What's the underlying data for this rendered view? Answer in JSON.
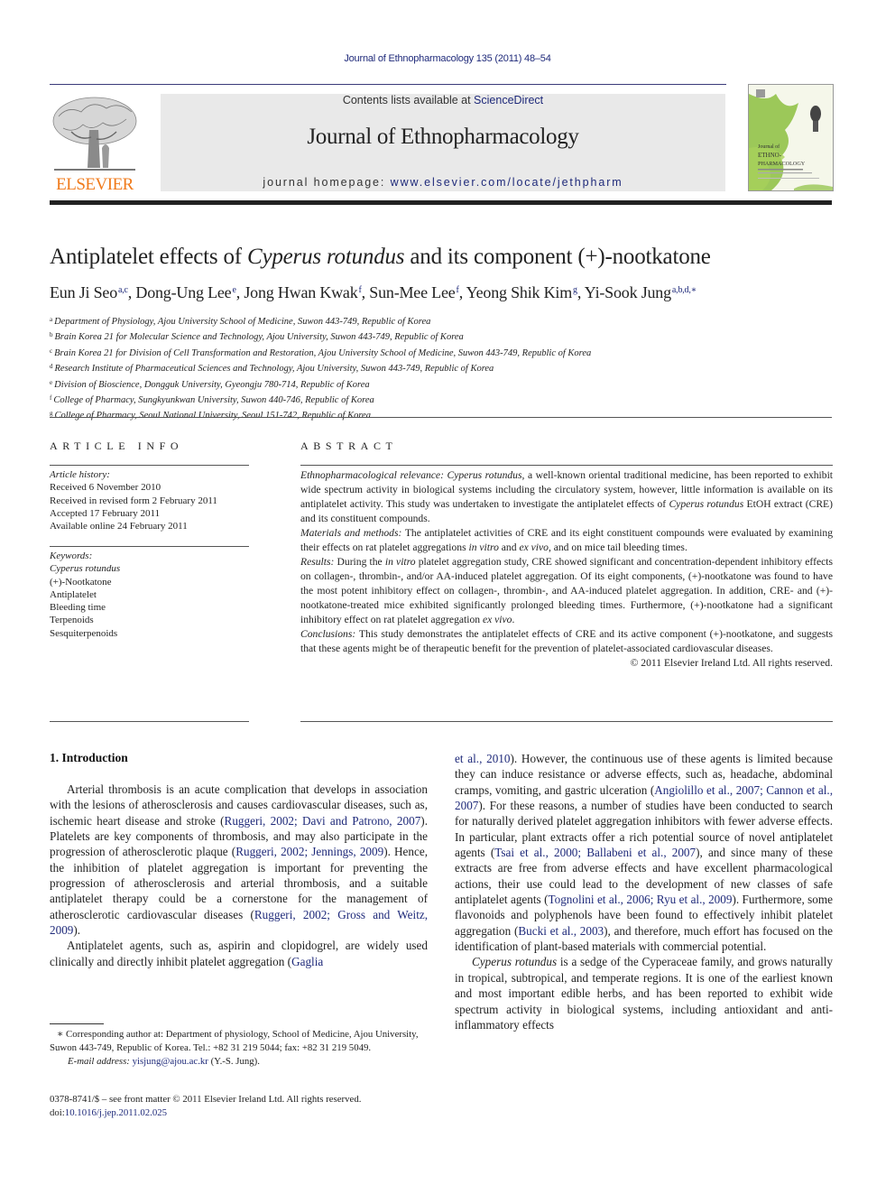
{
  "journal_citation": "Journal of Ethnopharmacology 135 (2011) 48–54",
  "masthead": {
    "publisher_logo_text": "ELSEVIER",
    "contents_prefix": "Contents lists available at ",
    "contents_link": "ScienceDirect",
    "journal_title": "Journal of Ethnopharmacology",
    "homepage_prefix": "journal homepage: ",
    "homepage_link": "www.elsevier.com/locate/jethpharm",
    "cover": {
      "line1": "Journal of",
      "line2": "ETHNO-",
      "line3": "PHARMACOLOGY"
    }
  },
  "article": {
    "title_part1": "Antiplatelet effects of ",
    "title_italic": "Cyperus rotundus",
    "title_part2": " and its component (+)-nootkatone",
    "authors": [
      {
        "name": "Eun Ji Seo",
        "sup": "a,c",
        "sep": ", "
      },
      {
        "name": "Dong-Ung Lee",
        "sup": "e",
        "sep": ", "
      },
      {
        "name": "Jong Hwan Kwak",
        "sup": "f",
        "sep": ", "
      },
      {
        "name": "Sun-Mee Lee",
        "sup": "f",
        "sep": ", "
      },
      {
        "name": "Yeong Shik Kim",
        "sup": "g",
        "sep": ", "
      },
      {
        "name": "Yi-Sook Jung",
        "sup": "a,b,d,∗",
        "sep": ""
      }
    ],
    "affiliations": [
      {
        "key": "a",
        "text": "Department of Physiology, Ajou University School of Medicine, Suwon 443-749, Republic of Korea"
      },
      {
        "key": "b",
        "text": "Brain Korea 21 for Molecular Science and Technology, Ajou University, Suwon 443-749, Republic of Korea"
      },
      {
        "key": "c",
        "text": "Brain Korea 21 for Division of Cell Transformation and Restoration, Ajou University School of Medicine, Suwon 443-749, Republic of Korea"
      },
      {
        "key": "d",
        "text": "Research Institute of Pharmaceutical Sciences and Technology, Ajou University, Suwon 443-749, Republic of Korea"
      },
      {
        "key": "e",
        "text": "Division of Bioscience, Dongguk University, Gyeongju 780-714, Republic of Korea"
      },
      {
        "key": "f",
        "text": "College of Pharmacy, Sungkyunkwan University, Suwon 440-746, Republic of Korea"
      },
      {
        "key": "g",
        "text": "College of Pharmacy, Seoul National University, Seoul 151-742, Republic of Korea"
      }
    ]
  },
  "article_info": {
    "heading": "ARTICLE INFO",
    "history_label": "Article history:",
    "history": [
      "Received 6 November 2010",
      "Received in revised form 2 February 2011",
      "Accepted 17 February 2011",
      "Available online 24 February 2011"
    ],
    "keywords_label": "Keywords:",
    "keywords": [
      "Cyperus rotundus",
      "(+)-Nootkatone",
      "Antiplatelet",
      "Bleeding time",
      "Terpenoids",
      "Sesquiterpenoids"
    ]
  },
  "abstract": {
    "heading": "ABSTRACT",
    "relevance_label": "Ethnopharmacological relevance:",
    "relevance_italic": "Cyperus rotundus",
    "relevance_text1": ", a well-known oriental traditional medicine, has been reported to exhibit wide spectrum activity in biological systems including the circulatory system, however, little information is available on its antiplatelet activity. This study was undertaken to investigate the antiplatelet effects of ",
    "relevance_italic2": "Cyperus rotundus",
    "relevance_text2": " EtOH extract (CRE) and its constituent compounds.",
    "methods_label": "Materials and methods:",
    "methods_text1": " The antiplatelet activities of CRE and its eight constituent compounds were evaluated by examining their effects on rat platelet aggregations ",
    "methods_italic1": "in vitro",
    "methods_text2": " and ",
    "methods_italic2": "ex vivo",
    "methods_text3": ", and on mice tail bleeding times.",
    "results_label": "Results:",
    "results_text1": " During the ",
    "results_italic1": "in vitro",
    "results_text2": " platelet aggregation study, CRE showed significant and concentration-dependent inhibitory effects on collagen-, thrombin-, and/or AA-induced platelet aggregation. Of its eight components, (+)-nootkatone was found to have the most potent inhibitory effect on collagen-, thrombin-, and AA-induced platelet aggregation. In addition, CRE- and (+)-nootkatone-treated mice exhibited significantly prolonged bleeding times. Furthermore, (+)-nootkatone had a significant inhibitory effect on rat platelet aggregation ",
    "results_italic2": "ex vivo",
    "results_text3": ".",
    "conclusions_label": "Conclusions:",
    "conclusions_text": " This study demonstrates the antiplatelet effects of CRE and its active component (+)-nootkatone, and suggests that these agents might be of therapeutic benefit for the prevention of platelet-associated cardiovascular diseases.",
    "copyright": "© 2011 Elsevier Ireland Ltd. All rights reserved."
  },
  "introduction": {
    "heading": "1.  Introduction",
    "p1": [
      {
        "t": "Arterial thrombosis is an acute complication that develops in association with the lesions of atherosclerosis and causes cardiovascular diseases, such as, ischemic heart disease and stroke ("
      },
      {
        "link": "Ruggeri, 2002; Davi and Patrono, 2007"
      },
      {
        "t": "). Platelets are key components of thrombosis, and may also participate in the progression of atherosclerotic plaque ("
      },
      {
        "link": "Ruggeri, 2002; Jennings, 2009"
      },
      {
        "t": "). Hence, the inhibition of platelet aggregation is important for preventing the progression of atherosclerosis and arterial thrombosis, and a suitable antiplatelet therapy could be a cornerstone for the management of atherosclerotic cardiovascular diseases ("
      },
      {
        "link": "Ruggeri, 2002; Gross and Weitz, 2009"
      },
      {
        "t": ")."
      }
    ],
    "p2_left": [
      {
        "t": "Antiplatelet agents, such as, aspirin and clopidogrel, are widely used clinically and directly inhibit platelet aggregation ("
      },
      {
        "link": "Gaglia"
      }
    ],
    "p2_right": [
      {
        "link": "et al., 2010"
      },
      {
        "t": "). However, the continuous use of these agents is limited because they can induce resistance or adverse effects, such as, headache, abdominal cramps, vomiting, and gastric ulceration ("
      },
      {
        "link": "Angiolillo et al., 2007; Cannon et al., 2007"
      },
      {
        "t": "). For these reasons, a number of studies have been conducted to search for naturally derived platelet aggregation inhibitors with fewer adverse effects. In particular, plant extracts offer a rich potential source of novel antiplatelet agents ("
      },
      {
        "link": "Tsai et al., 2000; Ballabeni et al., 2007"
      },
      {
        "t": "), and since many of these extracts are free from adverse effects and have excellent pharmacological actions, their use could lead to the development of new classes of safe antiplatelet agents ("
      },
      {
        "link": "Tognolini et al., 2006; Ryu et al., 2009"
      },
      {
        "t": "). Furthermore, some flavonoids and polyphenols have been found to effectively inhibit platelet aggregation ("
      },
      {
        "link": "Bucki et al., 2003"
      },
      {
        "t": "), and therefore, much effort has focused on the identification of plant-based materials with commercial potential."
      }
    ],
    "p3": [
      {
        "i": "Cyperus rotundus"
      },
      {
        "t": " is a sedge of the Cyperaceae family, and grows naturally in tropical, subtropical, and temperate regions. It is one of the earliest known and most important edible herbs, and has been reported to exhibit wide spectrum activity in biological systems, including antioxidant and anti-inflammatory effects"
      }
    ]
  },
  "footnote": {
    "marker": "∗",
    "text": " Corresponding author at: Department of physiology, School of Medicine, Ajou University, Suwon 443-749, Republic of Korea. Tel.: +82 31 219 5044; fax: +82 31 219 5049.",
    "email_label": "E-mail address:",
    "email": "yisjung@ajou.ac.kr",
    "email_suffix": " (Y.-S. Jung)."
  },
  "front_matter": {
    "issn_line": "0378-8741/$ – see front matter © 2011 Elsevier Ireland Ltd. All rights reserved.",
    "doi_prefix": "doi:",
    "doi": "10.1016/j.jep.2011.02.025"
  },
  "colors": {
    "link": "#1f2a7a",
    "elsevier_orange": "#f07a1b",
    "banner_bg": "#e9e9e9"
  }
}
